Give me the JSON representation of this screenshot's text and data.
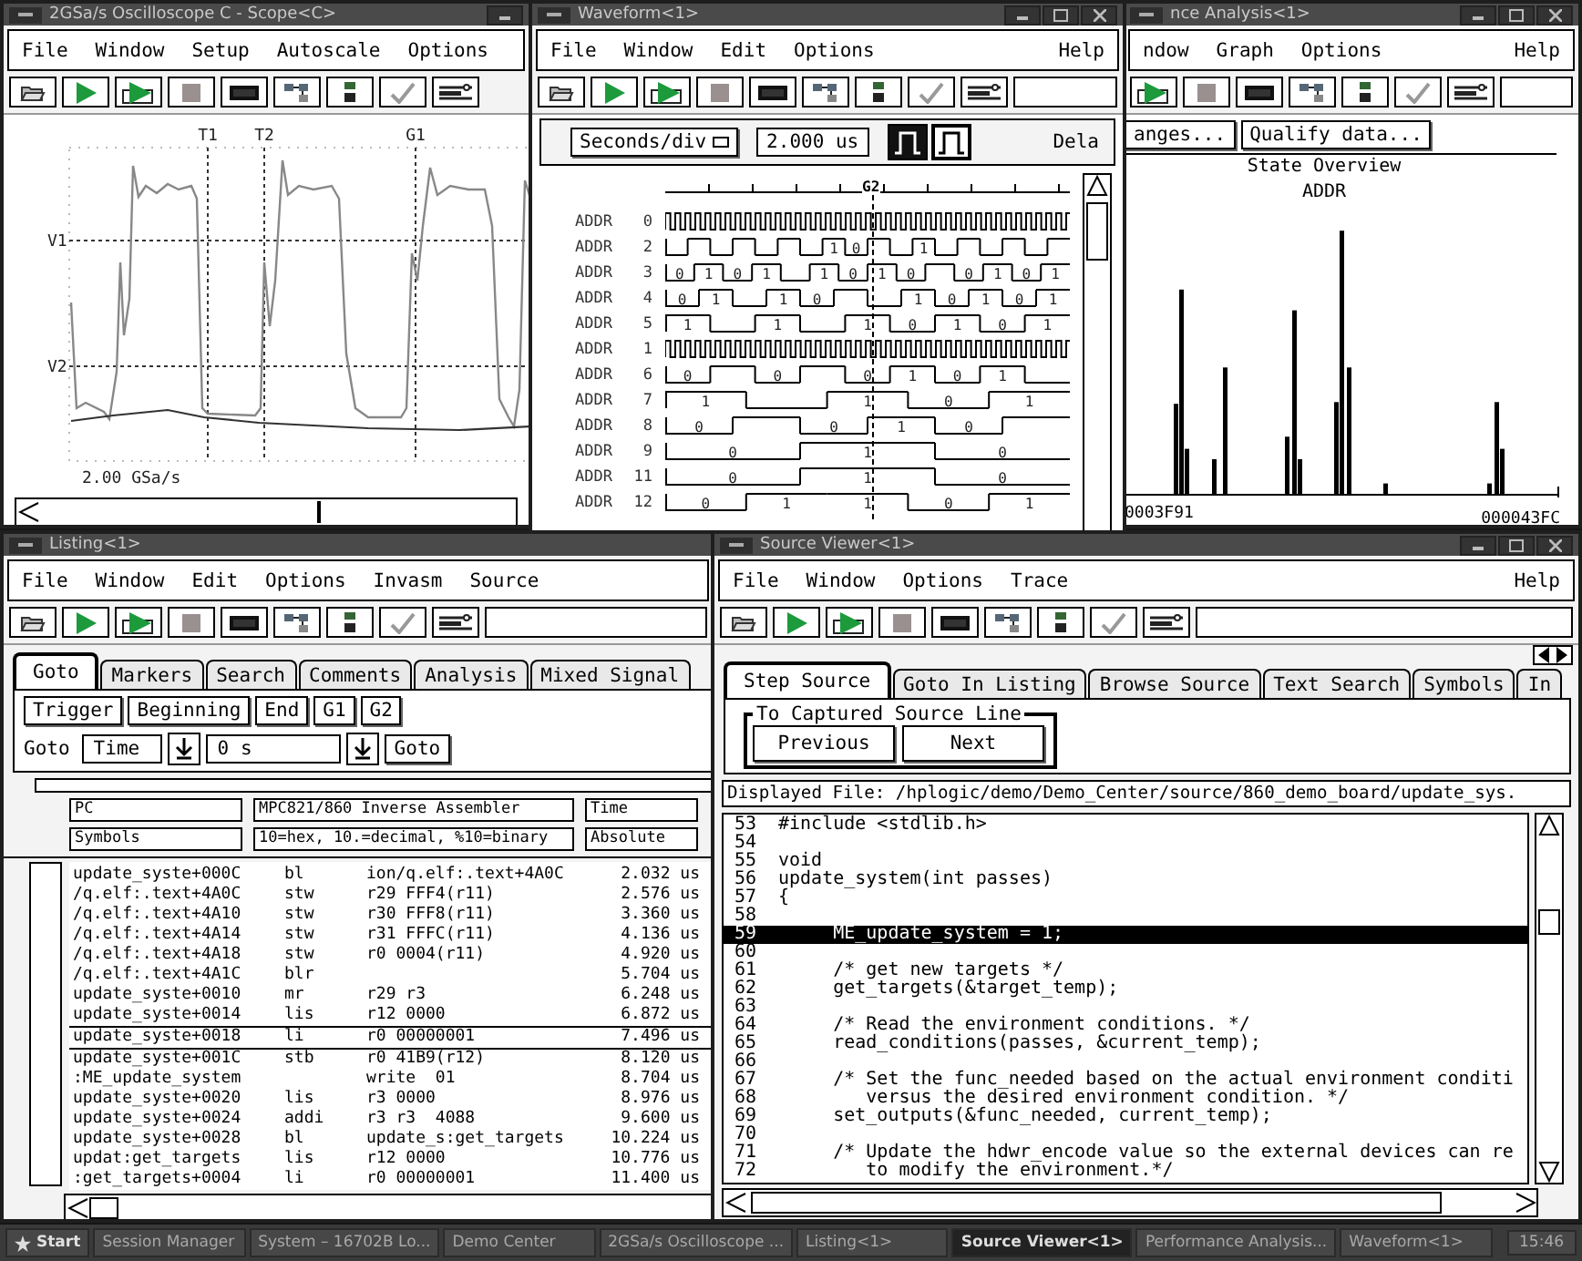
{
  "windows": [
    {
      "kind": "scope",
      "title": "2GSa/s Oscilloscope C - Scope<C>",
      "menu": [
        "File",
        "Window",
        "Setup",
        "Autoscale",
        "Options"
      ],
      "markers": [
        "T1",
        "T2",
        "G1"
      ],
      "levels": [
        "V1",
        "V2"
      ],
      "sample_rate": "2.00 GSa/s"
    },
    {
      "kind": "waveform",
      "title": "Waveform<1>",
      "menu": [
        "File",
        "Window",
        "Edit",
        "Options"
      ],
      "help_menu": "Help",
      "scale_mode": "Seconds/div",
      "scale_value": "2.000 us",
      "delay_label": "Dela",
      "marker": "G2",
      "rows": [
        {
          "bus": "ADDR",
          "bit": "0",
          "kind": "clock"
        },
        {
          "bus": "ADDR",
          "bit": "2",
          "kind": "bits",
          "segments": [
            {
              "high": false
            },
            {
              "high": true
            },
            {
              "high": false
            },
            {
              "high": true
            },
            {
              "high": false
            },
            {
              "high": true
            },
            {
              "high": false
            },
            {
              "high": true,
              "label": "1"
            },
            {
              "high": false,
              "label": "0"
            },
            {
              "high": true
            },
            {
              "high": false
            },
            {
              "high": true,
              "label": "1"
            },
            {
              "high": false
            },
            {
              "high": true
            },
            {
              "high": false
            },
            {
              "high": true
            },
            {
              "high": false
            },
            {
              "high": true
            }
          ]
        },
        {
          "bus": "ADDR",
          "bit": "3",
          "kind": "bits",
          "segments": [
            {
              "high": false,
              "label": "0"
            },
            {
              "high": true,
              "label": "1"
            },
            {
              "high": false,
              "label": "0"
            },
            {
              "high": true,
              "label": "1"
            },
            {
              "high": false
            },
            {
              "high": true,
              "label": "1"
            },
            {
              "high": false,
              "label": "0"
            },
            {
              "high": true,
              "label": "1"
            },
            {
              "high": false,
              "label": "0"
            },
            {
              "high": true
            },
            {
              "high": false,
              "label": "0"
            },
            {
              "high": true,
              "label": "1"
            },
            {
              "high": false,
              "label": "0"
            },
            {
              "high": true,
              "label": "1"
            }
          ]
        },
        {
          "bus": "ADDR",
          "bit": "4",
          "kind": "bits",
          "segments": [
            {
              "high": false,
              "label": "0"
            },
            {
              "high": true,
              "label": "1"
            },
            {
              "high": false
            },
            {
              "high": true,
              "label": "1"
            },
            {
              "high": false,
              "label": "0"
            },
            {
              "high": true
            },
            {
              "high": false
            },
            {
              "high": true,
              "label": "1"
            },
            {
              "high": false,
              "label": "0"
            },
            {
              "high": true,
              "label": "1"
            },
            {
              "high": false,
              "label": "0"
            },
            {
              "high": true,
              "label": "1"
            }
          ]
        },
        {
          "bus": "ADDR",
          "bit": "5",
          "kind": "bits",
          "segments": [
            {
              "high": true,
              "label": "1"
            },
            {
              "high": false
            },
            {
              "high": true,
              "label": "1"
            },
            {
              "high": false
            },
            {
              "high": true,
              "label": "1"
            },
            {
              "high": false,
              "label": "0"
            },
            {
              "high": true,
              "label": "1"
            },
            {
              "high": false,
              "label": "0"
            },
            {
              "high": true,
              "label": "1"
            }
          ]
        },
        {
          "bus": "ADDR",
          "bit": "1",
          "kind": "clock"
        },
        {
          "bus": "ADDR",
          "bit": "6",
          "kind": "bits",
          "segments": [
            {
              "high": false,
              "label": "0"
            },
            {
              "high": true
            },
            {
              "high": false,
              "label": "0"
            },
            {
              "high": true
            },
            {
              "high": false,
              "label": "0"
            },
            {
              "high": true,
              "label": "1"
            },
            {
              "high": false,
              "label": "0"
            },
            {
              "high": true,
              "label": "1"
            },
            {
              "high": false
            }
          ]
        },
        {
          "bus": "ADDR",
          "bit": "7",
          "kind": "bits",
          "segments": [
            {
              "high": true,
              "label": "1"
            },
            {
              "high": false
            },
            {
              "high": true,
              "label": "1"
            },
            {
              "high": false,
              "label": "0"
            },
            {
              "high": true,
              "label": "1"
            }
          ]
        },
        {
          "bus": "ADDR",
          "bit": "8",
          "kind": "bits",
          "segments": [
            {
              "high": false,
              "label": "0"
            },
            {
              "high": true
            },
            {
              "high": false,
              "label": "0"
            },
            {
              "high": true,
              "label": "1"
            },
            {
              "high": false,
              "label": "0"
            },
            {
              "high": true
            }
          ]
        },
        {
          "bus": "ADDR",
          "bit": "9",
          "kind": "bits",
          "segments": [
            {
              "high": false,
              "label": "0"
            },
            {
              "high": true,
              "label": "1"
            },
            {
              "high": false,
              "label": "0"
            }
          ]
        },
        {
          "bus": "ADDR",
          "bit": "11",
          "kind": "bits",
          "segments": [
            {
              "high": false,
              "label": "0"
            },
            {
              "high": true,
              "label": "1"
            },
            {
              "high": false,
              "label": "0"
            }
          ]
        },
        {
          "bus": "ADDR",
          "bit": "12",
          "kind": "bits",
          "segments": [
            {
              "high": false,
              "label": "0"
            },
            {
              "high": true,
              "label": "1"
            },
            {
              "high": true,
              "label": "1"
            },
            {
              "high": false,
              "label": "0"
            },
            {
              "high": true,
              "label": "1"
            }
          ]
        }
      ]
    },
    {
      "kind": "analysis",
      "title": "nce Analysis<1>",
      "menu": [
        "ndow",
        "Graph",
        "Options"
      ],
      "help_menu": "Help",
      "buttons": [
        "anges...",
        "Qualify data..."
      ],
      "chart_title": "State Overview",
      "chart_subtitle": "ADDR",
      "axis_start": "0003F91",
      "axis_end": "000043FC"
    },
    {
      "kind": "listing",
      "title": "Listing<1>",
      "menu": [
        "File",
        "Window",
        "Edit",
        "Options",
        "Invasm",
        "Source"
      ],
      "tabs": [
        {
          "label": "Goto",
          "selected": true
        },
        {
          "label": "Markers",
          "selected": false
        },
        {
          "label": "Search",
          "selected": false
        },
        {
          "label": "Comments",
          "selected": false
        },
        {
          "label": "Analysis",
          "selected": false
        },
        {
          "label": "Mixed Signal",
          "selected": false
        }
      ],
      "goto_buttons": [
        "Trigger",
        "Beginning",
        "End",
        "G1",
        "G2"
      ],
      "goto_label": "Goto",
      "goto_type": "Time",
      "goto_value": "0 s",
      "goto_action": "Goto",
      "header": [
        [
          "PC",
          "MPC821/860 Inverse Assembler",
          "Time"
        ],
        [
          "Symbols",
          "10=hex,  10.=decimal, %10=binary",
          "Absolute"
        ]
      ],
      "rows": [
        {
          "label": "update_syste+000C",
          "opcode": "bl",
          "operand": "ion/q.elf:.text+4A0C",
          "time": "2.032 us",
          "selected": false
        },
        {
          "label": "/q.elf:.text+4A0C",
          "opcode": "stw",
          "operand": "r29 FFF4(r11)",
          "time": "2.576 us",
          "selected": false
        },
        {
          "label": "/q.elf:.text+4A10",
          "opcode": "stw",
          "operand": "r30 FFF8(r11)",
          "time": "3.360 us",
          "selected": false
        },
        {
          "label": "/q.elf:.text+4A14",
          "opcode": "stw",
          "operand": "r31 FFFC(r11)",
          "time": "4.136 us",
          "selected": false
        },
        {
          "label": "/q.elf:.text+4A18",
          "opcode": "stw",
          "operand": "r0 0004(r11)",
          "time": "4.920 us",
          "selected": false
        },
        {
          "label": "/q.elf:.text+4A1C",
          "opcode": "blr",
          "time": "5.704 us",
          "selected": false
        },
        {
          "label": "update_syste+0010",
          "opcode": "mr",
          "operand": "r29 r3",
          "time": "6.248 us",
          "selected": false
        },
        {
          "label": "update_syste+0014",
          "opcode": "lis",
          "operand": "r12 0000",
          "time": "6.872 us",
          "selected": false
        },
        {
          "label": "update_syste+0018",
          "opcode": "li",
          "operand": "r0 00000001",
          "time": "7.496 us",
          "selected": true
        },
        {
          "label": "update_syste+001C",
          "opcode": "stb",
          "operand": "r0 41B9(r12)",
          "time": "8.120 us",
          "selected": false
        },
        {
          "label": ":ME_update_system",
          "operand": "write  01",
          "time": "8.704 us",
          "selected": false
        },
        {
          "label": "update_syste+0020",
          "opcode": "lis",
          "operand": "r3 0000",
          "time": "8.976 us",
          "selected": false
        },
        {
          "label": "update_syste+0024",
          "opcode": "addi",
          "operand": "r3 r3  4088",
          "time": "9.600 us",
          "selected": false
        },
        {
          "label": "update_syste+0028",
          "opcode": "bl",
          "operand": "update_s:get_targets",
          "time": "10.224 us",
          "selected": false
        },
        {
          "label": "updat:get_targets",
          "opcode": "lis",
          "operand": "r12 0000",
          "time": "10.776 us",
          "selected": false
        },
        {
          "label": ":get_targets+0004",
          "opcode": "li",
          "operand": "r0 00000001",
          "time": "11.400 us",
          "selected": false
        }
      ]
    },
    {
      "kind": "source",
      "title": "Source Viewer<1>",
      "menu": [
        "File",
        "Window",
        "Options",
        "Trace"
      ],
      "help_menu": "Help",
      "tabs": [
        {
          "label": "Step Source",
          "selected": true
        },
        {
          "label": "Goto In Listing",
          "selected": false
        },
        {
          "label": "Browse Source",
          "selected": false
        },
        {
          "label": "Text Search",
          "selected": false
        },
        {
          "label": "Symbols",
          "selected": false
        },
        {
          "label": "In",
          "selected": false
        }
      ],
      "group_title": "To Captured Source Line",
      "buttons": [
        "Previous",
        "Next"
      ],
      "displayed_file": "Displayed File: /hplogic/demo/Demo_Center/source/860_demo_board/update_sys.",
      "lines": [
        {
          "number": "53",
          "code": "#include <stdlib.h>",
          "selected": false
        },
        {
          "number": "54",
          "selected": false
        },
        {
          "number": "55",
          "code": "void",
          "selected": false
        },
        {
          "number": "56",
          "code": "update_system(int passes)",
          "selected": false
        },
        {
          "number": "57",
          "code": "{",
          "selected": false
        },
        {
          "number": "58",
          "selected": false
        },
        {
          "number": "59",
          "code": "     ME_update_system = 1;",
          "selected": true
        },
        {
          "number": "60",
          "selected": false
        },
        {
          "number": "61",
          "code": "     /* get new targets */",
          "selected": false
        },
        {
          "number": "62",
          "code": "     get_targets(&target_temp);",
          "selected": false
        },
        {
          "number": "63",
          "selected": false
        },
        {
          "number": "64",
          "code": "     /* Read the environment conditions. */",
          "selected": false
        },
        {
          "number": "65",
          "code": "     read_conditions(passes, &current_temp);",
          "selected": false
        },
        {
          "number": "66",
          "selected": false
        },
        {
          "number": "67",
          "code": "     /* Set the func_needed based on the actual environment conditi",
          "selected": false
        },
        {
          "number": "68",
          "code": "        versus the desired environment condition. */",
          "selected": false
        },
        {
          "number": "69",
          "code": "     set_outputs(&func_needed, current_temp);",
          "selected": false
        },
        {
          "number": "70",
          "selected": false
        },
        {
          "number": "71",
          "code": "     /* Update the hdwr_encode value so the external devices can re",
          "selected": false
        },
        {
          "number": "72",
          "code": "        to modify the environment.*/",
          "selected": false
        }
      ]
    }
  ],
  "taskbar": {
    "start": "Start",
    "items": [
      {
        "label": "Session Manager",
        "selected": false
      },
      {
        "label": "System – 16702B Lo...",
        "selected": false
      },
      {
        "label": "Demo Center",
        "selected": false
      },
      {
        "label": "2GSa/s Oscilloscope ...",
        "selected": false
      },
      {
        "label": "Listing<1>",
        "selected": false
      },
      {
        "label": "Source Viewer<1>",
        "selected": true
      },
      {
        "label": "Performance Analysis...",
        "selected": false
      },
      {
        "label": "Waveform<1>",
        "selected": false
      }
    ],
    "clock": "15:46"
  }
}
